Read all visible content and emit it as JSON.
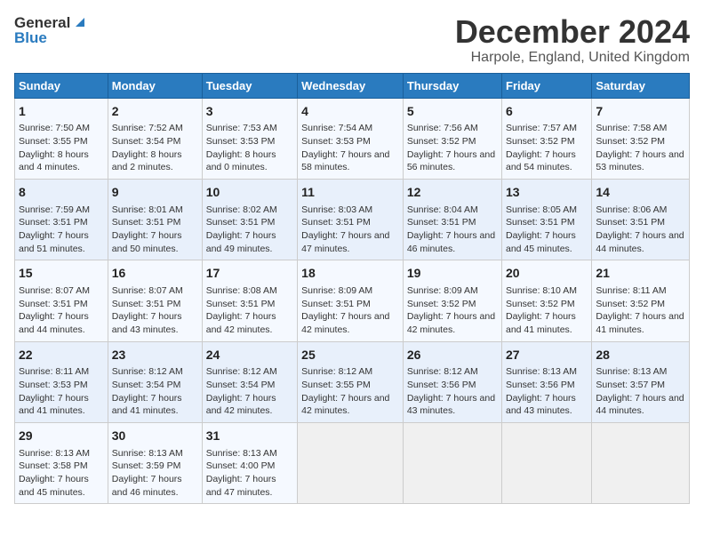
{
  "logo": {
    "general": "General",
    "blue": "Blue"
  },
  "title": "December 2024",
  "subtitle": "Harpole, England, United Kingdom",
  "days_header": [
    "Sunday",
    "Monday",
    "Tuesday",
    "Wednesday",
    "Thursday",
    "Friday",
    "Saturday"
  ],
  "weeks": [
    [
      {
        "day": "1",
        "sunrise": "Sunrise: 7:50 AM",
        "sunset": "Sunset: 3:55 PM",
        "daylight": "Daylight: 8 hours and 4 minutes."
      },
      {
        "day": "2",
        "sunrise": "Sunrise: 7:52 AM",
        "sunset": "Sunset: 3:54 PM",
        "daylight": "Daylight: 8 hours and 2 minutes."
      },
      {
        "day": "3",
        "sunrise": "Sunrise: 7:53 AM",
        "sunset": "Sunset: 3:53 PM",
        "daylight": "Daylight: 8 hours and 0 minutes."
      },
      {
        "day": "4",
        "sunrise": "Sunrise: 7:54 AM",
        "sunset": "Sunset: 3:53 PM",
        "daylight": "Daylight: 7 hours and 58 minutes."
      },
      {
        "day": "5",
        "sunrise": "Sunrise: 7:56 AM",
        "sunset": "Sunset: 3:52 PM",
        "daylight": "Daylight: 7 hours and 56 minutes."
      },
      {
        "day": "6",
        "sunrise": "Sunrise: 7:57 AM",
        "sunset": "Sunset: 3:52 PM",
        "daylight": "Daylight: 7 hours and 54 minutes."
      },
      {
        "day": "7",
        "sunrise": "Sunrise: 7:58 AM",
        "sunset": "Sunset: 3:52 PM",
        "daylight": "Daylight: 7 hours and 53 minutes."
      }
    ],
    [
      {
        "day": "8",
        "sunrise": "Sunrise: 7:59 AM",
        "sunset": "Sunset: 3:51 PM",
        "daylight": "Daylight: 7 hours and 51 minutes."
      },
      {
        "day": "9",
        "sunrise": "Sunrise: 8:01 AM",
        "sunset": "Sunset: 3:51 PM",
        "daylight": "Daylight: 7 hours and 50 minutes."
      },
      {
        "day": "10",
        "sunrise": "Sunrise: 8:02 AM",
        "sunset": "Sunset: 3:51 PM",
        "daylight": "Daylight: 7 hours and 49 minutes."
      },
      {
        "day": "11",
        "sunrise": "Sunrise: 8:03 AM",
        "sunset": "Sunset: 3:51 PM",
        "daylight": "Daylight: 7 hours and 47 minutes."
      },
      {
        "day": "12",
        "sunrise": "Sunrise: 8:04 AM",
        "sunset": "Sunset: 3:51 PM",
        "daylight": "Daylight: 7 hours and 46 minutes."
      },
      {
        "day": "13",
        "sunrise": "Sunrise: 8:05 AM",
        "sunset": "Sunset: 3:51 PM",
        "daylight": "Daylight: 7 hours and 45 minutes."
      },
      {
        "day": "14",
        "sunrise": "Sunrise: 8:06 AM",
        "sunset": "Sunset: 3:51 PM",
        "daylight": "Daylight: 7 hours and 44 minutes."
      }
    ],
    [
      {
        "day": "15",
        "sunrise": "Sunrise: 8:07 AM",
        "sunset": "Sunset: 3:51 PM",
        "daylight": "Daylight: 7 hours and 44 minutes."
      },
      {
        "day": "16",
        "sunrise": "Sunrise: 8:07 AM",
        "sunset": "Sunset: 3:51 PM",
        "daylight": "Daylight: 7 hours and 43 minutes."
      },
      {
        "day": "17",
        "sunrise": "Sunrise: 8:08 AM",
        "sunset": "Sunset: 3:51 PM",
        "daylight": "Daylight: 7 hours and 42 minutes."
      },
      {
        "day": "18",
        "sunrise": "Sunrise: 8:09 AM",
        "sunset": "Sunset: 3:51 PM",
        "daylight": "Daylight: 7 hours and 42 minutes."
      },
      {
        "day": "19",
        "sunrise": "Sunrise: 8:09 AM",
        "sunset": "Sunset: 3:52 PM",
        "daylight": "Daylight: 7 hours and 42 minutes."
      },
      {
        "day": "20",
        "sunrise": "Sunrise: 8:10 AM",
        "sunset": "Sunset: 3:52 PM",
        "daylight": "Daylight: 7 hours and 41 minutes."
      },
      {
        "day": "21",
        "sunrise": "Sunrise: 8:11 AM",
        "sunset": "Sunset: 3:52 PM",
        "daylight": "Daylight: 7 hours and 41 minutes."
      }
    ],
    [
      {
        "day": "22",
        "sunrise": "Sunrise: 8:11 AM",
        "sunset": "Sunset: 3:53 PM",
        "daylight": "Daylight: 7 hours and 41 minutes."
      },
      {
        "day": "23",
        "sunrise": "Sunrise: 8:12 AM",
        "sunset": "Sunset: 3:54 PM",
        "daylight": "Daylight: 7 hours and 41 minutes."
      },
      {
        "day": "24",
        "sunrise": "Sunrise: 8:12 AM",
        "sunset": "Sunset: 3:54 PM",
        "daylight": "Daylight: 7 hours and 42 minutes."
      },
      {
        "day": "25",
        "sunrise": "Sunrise: 8:12 AM",
        "sunset": "Sunset: 3:55 PM",
        "daylight": "Daylight: 7 hours and 42 minutes."
      },
      {
        "day": "26",
        "sunrise": "Sunrise: 8:12 AM",
        "sunset": "Sunset: 3:56 PM",
        "daylight": "Daylight: 7 hours and 43 minutes."
      },
      {
        "day": "27",
        "sunrise": "Sunrise: 8:13 AM",
        "sunset": "Sunset: 3:56 PM",
        "daylight": "Daylight: 7 hours and 43 minutes."
      },
      {
        "day": "28",
        "sunrise": "Sunrise: 8:13 AM",
        "sunset": "Sunset: 3:57 PM",
        "daylight": "Daylight: 7 hours and 44 minutes."
      }
    ],
    [
      {
        "day": "29",
        "sunrise": "Sunrise: 8:13 AM",
        "sunset": "Sunset: 3:58 PM",
        "daylight": "Daylight: 7 hours and 45 minutes."
      },
      {
        "day": "30",
        "sunrise": "Sunrise: 8:13 AM",
        "sunset": "Sunset: 3:59 PM",
        "daylight": "Daylight: 7 hours and 46 minutes."
      },
      {
        "day": "31",
        "sunrise": "Sunrise: 8:13 AM",
        "sunset": "Sunset: 4:00 PM",
        "daylight": "Daylight: 7 hours and 47 minutes."
      },
      null,
      null,
      null,
      null
    ]
  ]
}
